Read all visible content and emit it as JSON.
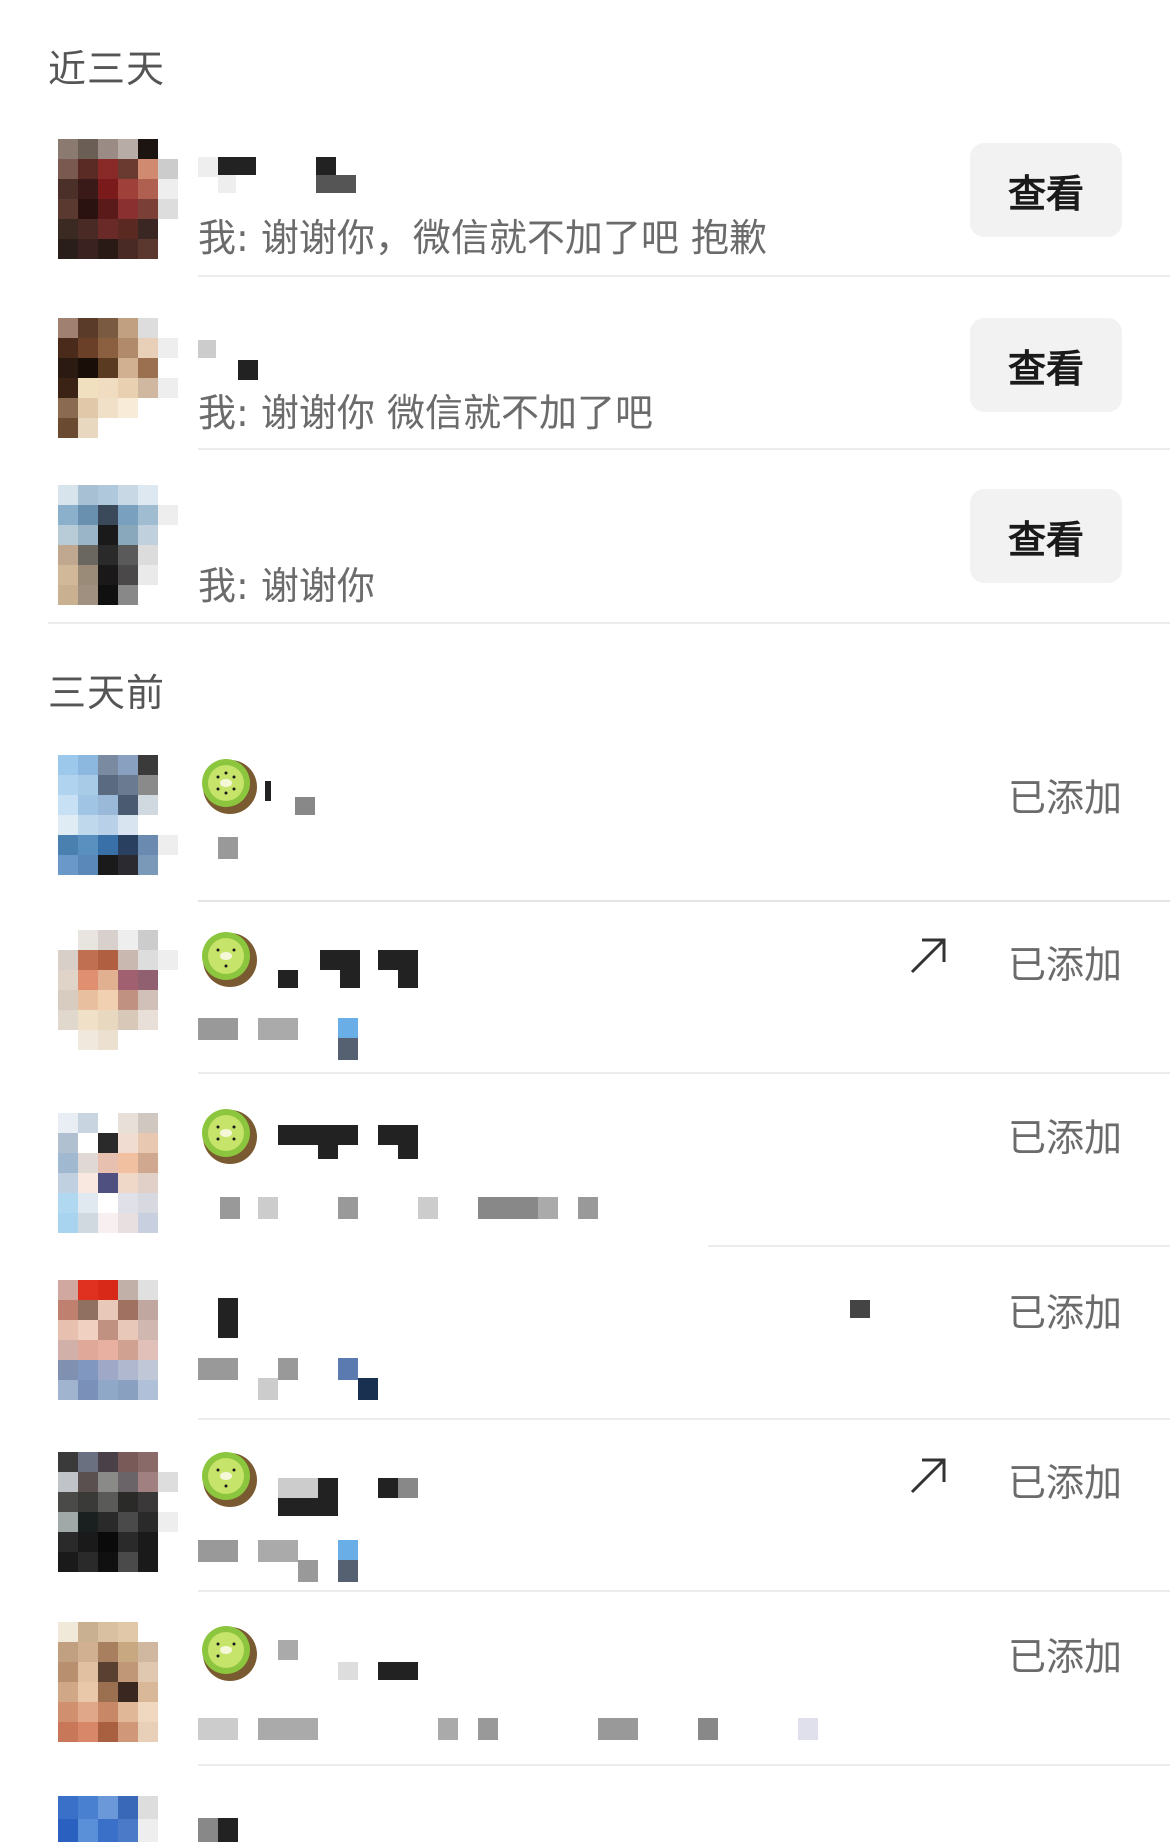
{
  "sections": {
    "recent_title": "近三天",
    "older_title": "三天前"
  },
  "recent": [
    {
      "message": "我: 谢谢你，微信就不加了吧 抱歉",
      "button": "查看"
    },
    {
      "message": "我: 谢谢你 微信就不加了吧",
      "button": "查看"
    },
    {
      "message": "我: 谢谢你",
      "button": "查看"
    }
  ],
  "older": [
    {
      "status": "已添加",
      "share_icon": false,
      "kiwi_icon": true
    },
    {
      "status": "已添加",
      "share_icon": true,
      "kiwi_icon": true
    },
    {
      "status": "已添加",
      "share_icon": false,
      "kiwi_icon": true
    },
    {
      "status": "已添加",
      "share_icon": false,
      "kiwi_icon": false
    },
    {
      "status": "已添加",
      "share_icon": true,
      "kiwi_icon": true
    },
    {
      "status": "已添加",
      "share_icon": false,
      "kiwi_icon": true
    }
  ],
  "icons": {
    "kiwi": "kiwi-emoji-icon",
    "share": "share-arrow-icon"
  },
  "colors": {
    "button_bg": "#f2f2f2",
    "secondary_text": "#6b6b6b",
    "divider": "#ececec"
  }
}
